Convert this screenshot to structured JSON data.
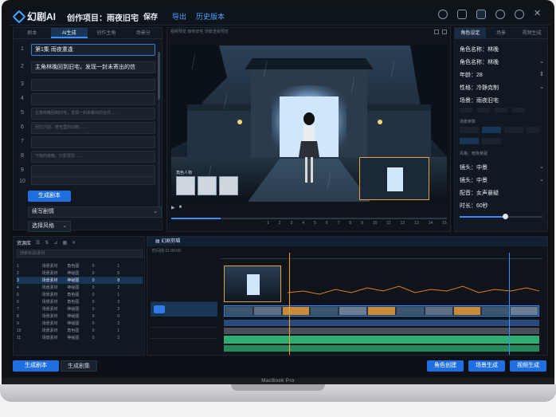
{
  "app": {
    "name": "幻剧AI",
    "project_title": "创作项目：雨夜旧宅",
    "save": "保存",
    "export": "导出",
    "history": "历史版本"
  },
  "left_panel": {
    "tabs": [
      "剧本",
      "AI生成",
      "创作主角",
      "场景分"
    ],
    "active_tab": 1,
    "lines": [
      {
        "num": "1",
        "text": "第1集  雨夜重逢"
      },
      {
        "num": "2",
        "text": "主角林晚回到旧宅，发现一封未寄出的信"
      },
      {
        "num": "3",
        "text": ""
      },
      {
        "num": "4",
        "text": ""
      },
      {
        "num": "5",
        "text": "主角林晚回到旧宅，发现一封未寄出的信件……"
      },
      {
        "num": "6",
        "text": "回忆闪现，老宅里的旧物……"
      },
      {
        "num": "7",
        "text": ""
      },
      {
        "num": "8",
        "text": "下雨的夜晚，灯影斑驳……"
      },
      {
        "num": "9",
        "text": ""
      },
      {
        "num": "10",
        "text": ""
      }
    ],
    "generate_button": "生成剧本",
    "select_1": "续写剧情",
    "select_2": "选择风格"
  },
  "preview": {
    "header": "视频预览  雨夜旧宅 场景渲染预览",
    "characters_label": "角色人物",
    "timecodes": [
      "1",
      "2",
      "3",
      "4",
      "5",
      "6",
      "7",
      "8",
      "9",
      "10",
      "11",
      "12",
      "13",
      "14",
      "15"
    ],
    "progress": 0.18
  },
  "right_panel": {
    "tabs": [
      "角色设定",
      "场景",
      "视频生成"
    ],
    "active_tab": 0,
    "role_name": "角色名称：林晚",
    "role_name_2": "角色名称：林晚",
    "age": "年龄：28",
    "personality": "性格：冷静克制",
    "scene": "场景：雨夜旧宅",
    "section_1": "场景参数",
    "section_2": "风格：暗夜悬疑",
    "shot_1": "镜头：中景",
    "shot_2": "镜头：中景",
    "voice": "配音：女声悬疑",
    "duration": "时长：60秒",
    "duration_value": 0.55
  },
  "assets": {
    "title": "资源库",
    "search_placeholder": "搜索资源/素材",
    "rows": [
      [
        "1",
        "场景素材",
        "角色图",
        "0",
        "1"
      ],
      [
        "2",
        "场景素材",
        "神秘图",
        "0",
        "5"
      ],
      [
        "3",
        "场景素材",
        "神秘图",
        "0",
        "8"
      ],
      [
        "4",
        "场景素材",
        "神秘图",
        "0",
        "2"
      ],
      [
        "5",
        "场景素材",
        "角色图",
        "0",
        "1"
      ],
      [
        "6",
        "场景素材",
        "角色图",
        "0",
        "3"
      ],
      [
        "7",
        "场景素材",
        "神秘图",
        "0",
        "2"
      ],
      [
        "8",
        "场景素材",
        "神秘图",
        "0",
        "0"
      ],
      [
        "9",
        "场景素材",
        "神秘图",
        "0",
        "2"
      ],
      [
        "10",
        "场景素材",
        "角色图",
        "0",
        "1"
      ],
      [
        "11",
        "场景素材",
        "神秘图",
        "0",
        "2"
      ]
    ]
  },
  "timeline": {
    "title": "幻剧剪辑",
    "subtitle": "时间线  01:00:00"
  },
  "bottom_bar": {
    "generate_script": "生成剧本",
    "continue_script": "生成剧集",
    "character_create": "角色创建",
    "scene_generate": "场景生成",
    "video_generate": "视频生成"
  },
  "laptop_brand": "MacBook Pro",
  "colors": {
    "accent": "#1f6fe0",
    "playhead": "#ff9a2b",
    "audio_track": "#2fae74"
  }
}
